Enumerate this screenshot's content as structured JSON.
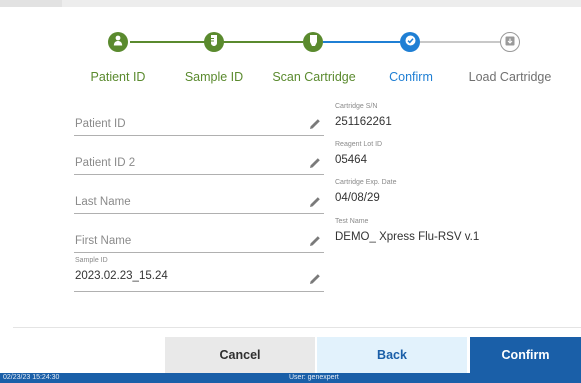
{
  "stepper": {
    "steps": [
      {
        "label": "Patient ID",
        "state": "done",
        "icon": "person-icon"
      },
      {
        "label": "Sample ID",
        "state": "done",
        "icon": "tube-icon"
      },
      {
        "label": "Scan Cartridge",
        "state": "done",
        "icon": "cartridge-icon"
      },
      {
        "label": "Confirm",
        "state": "active",
        "icon": "check-icon"
      },
      {
        "label": "Load Cartridge",
        "state": "pending",
        "icon": "load-icon"
      }
    ],
    "colors": {
      "done": "#5a8a2e",
      "active": "#1f7fd4",
      "pending": "#9a9a9a"
    }
  },
  "form": {
    "patient_id": {
      "placeholder": "Patient ID",
      "value": ""
    },
    "patient_id_2": {
      "placeholder": "Patient ID 2",
      "value": ""
    },
    "last_name": {
      "placeholder": "Last Name",
      "value": ""
    },
    "first_name": {
      "placeholder": "First Name",
      "value": ""
    },
    "sample_id": {
      "label": "Sample ID",
      "value": "2023.02.23_15.24"
    }
  },
  "info": {
    "cartridge_sn": {
      "label": "Cartridge S/N",
      "value": "251162261"
    },
    "reagent_lot": {
      "label": "Reagent Lot ID",
      "value": "05464"
    },
    "exp_date": {
      "label": "Cartridge Exp. Date",
      "value": "04/08/29"
    },
    "test_name": {
      "label": "Test Name",
      "value": "DEMO_ Xpress Flu-RSV v.1"
    }
  },
  "buttons": {
    "cancel": "Cancel",
    "back": "Back",
    "confirm": "Confirm"
  },
  "status": {
    "datetime": "02/23/23 15:24:30",
    "user": "User: genexpert"
  }
}
